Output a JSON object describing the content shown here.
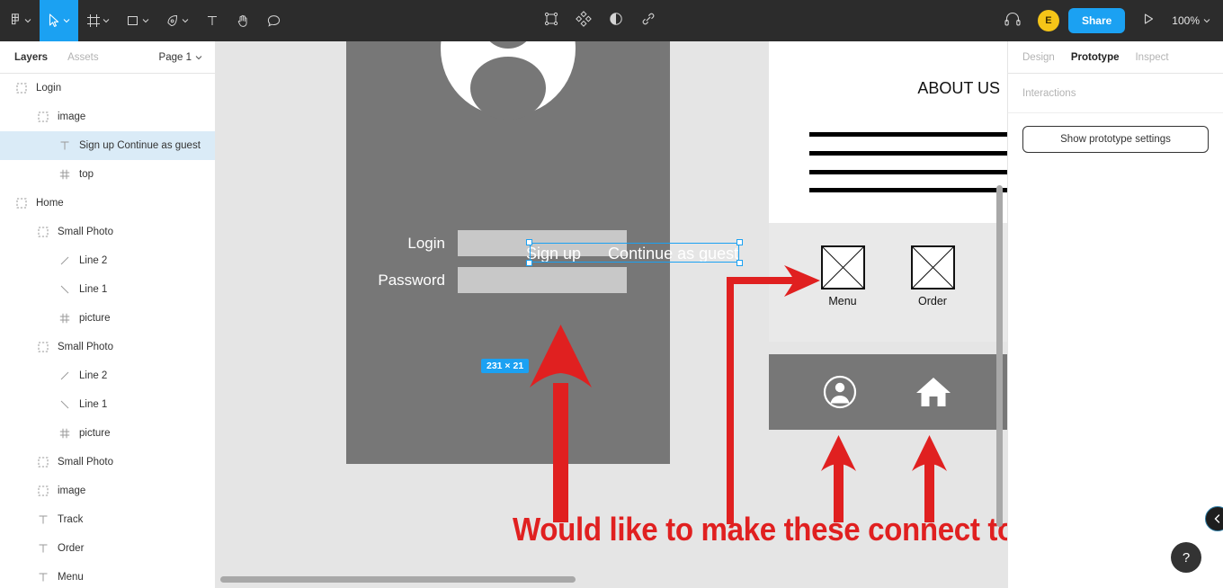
{
  "toolbar": {
    "tools": [
      {
        "name": "figma-logo-icon",
        "caret": true
      },
      {
        "name": "move-tool-icon",
        "caret": true,
        "active": true
      },
      {
        "name": "frame-tool-icon",
        "caret": true
      },
      {
        "name": "shape-tool-icon",
        "caret": true
      },
      {
        "name": "pen-tool-icon",
        "caret": true
      },
      {
        "name": "text-tool-icon",
        "caret": false
      },
      {
        "name": "hand-tool-icon",
        "caret": false
      },
      {
        "name": "comment-tool-icon",
        "caret": false
      }
    ],
    "center_icons": [
      "selection-frame-icon",
      "component-icon",
      "mask-icon",
      "link-icon"
    ],
    "headphones_icon": "headphones-icon",
    "avatar_initial": "E",
    "avatar_color": "#f5c518",
    "share_label": "Share",
    "present_icon": "present-play-icon",
    "zoom_label": "100%",
    "accent_color": "#1ba1f2",
    "background_color": "#2c2c2c"
  },
  "left_panel": {
    "tabs": [
      {
        "label": "Layers",
        "active": true
      },
      {
        "label": "Assets",
        "active": false
      }
    ],
    "page_label": "Page 1",
    "layers": [
      {
        "label": "Login",
        "icon": "frame-icon",
        "indent": 0,
        "selected": false
      },
      {
        "label": "image",
        "icon": "frame-icon",
        "indent": 1,
        "selected": false
      },
      {
        "label": "Sign up Continue as guest",
        "icon": "text-layer-icon",
        "indent": 2,
        "selected": true
      },
      {
        "label": "top",
        "icon": "component-icon",
        "indent": 2,
        "selected": false
      },
      {
        "label": "Home",
        "icon": "frame-icon",
        "indent": 0,
        "selected": false
      },
      {
        "label": "Small Photo",
        "icon": "frame-icon",
        "indent": 1,
        "selected": false
      },
      {
        "label": "Line 2",
        "icon": "line-up-icon",
        "indent": 2,
        "selected": false
      },
      {
        "label": "Line 1",
        "icon": "line-down-icon",
        "indent": 2,
        "selected": false
      },
      {
        "label": "picture",
        "icon": "component-icon",
        "indent": 2,
        "selected": false
      },
      {
        "label": "Small Photo",
        "icon": "frame-icon",
        "indent": 1,
        "selected": false
      },
      {
        "label": "Line 2",
        "icon": "line-up-icon",
        "indent": 2,
        "selected": false
      },
      {
        "label": "Line 1",
        "icon": "line-down-icon",
        "indent": 2,
        "selected": false
      },
      {
        "label": "picture",
        "icon": "component-icon",
        "indent": 2,
        "selected": false
      },
      {
        "label": "Small Photo",
        "icon": "frame-icon",
        "indent": 1,
        "selected": false
      },
      {
        "label": "image",
        "icon": "frame-icon",
        "indent": 1,
        "selected": false
      },
      {
        "label": "Track",
        "icon": "text-layer-icon",
        "indent": 1,
        "selected": false
      },
      {
        "label": "Order",
        "icon": "text-layer-icon",
        "indent": 1,
        "selected": false
      },
      {
        "label": "Menu",
        "icon": "text-layer-icon",
        "indent": 1,
        "selected": false
      }
    ]
  },
  "canvas": {
    "login_frame": {
      "avatar_icon": "user-avatar-glyph",
      "fields": [
        {
          "label": "Login",
          "value": ""
        },
        {
          "label": "Password",
          "value": ""
        }
      ],
      "selected_text": "Sign up      Continue as guest",
      "size_badge": "231 × 21"
    },
    "about_frame": {
      "title": "ABOUT US",
      "text_lines": 4
    },
    "home_frame": {
      "placeholders": [
        {
          "label": "Menu",
          "icon": "image-placeholder-icon"
        },
        {
          "label": "Order",
          "icon": "image-placeholder-icon"
        }
      ],
      "nav_icons": [
        {
          "name": "account-icon"
        },
        {
          "name": "home-icon"
        }
      ]
    },
    "annotation": {
      "text": "Would like to make these connect to a frame",
      "color": "#e02020",
      "arrows": [
        "arrow-up-to-signup-text",
        "elbow-arrow-to-menu-placeholder",
        "arrow-up-to-account-icon",
        "arrow-up-to-home-icon"
      ]
    }
  },
  "right_panel": {
    "tabs": [
      {
        "label": "Design",
        "active": false
      },
      {
        "label": "Prototype",
        "active": true
      },
      {
        "label": "Inspect",
        "active": false
      }
    ],
    "section_title": "Interactions",
    "prototype_settings_label": "Show prototype settings",
    "help_label": "?",
    "collapse_icon": "chevron-left-icon"
  }
}
